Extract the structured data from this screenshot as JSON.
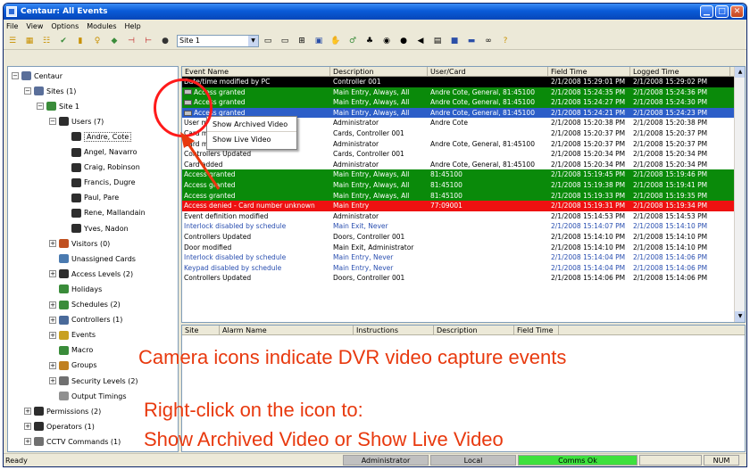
{
  "window": {
    "title": "Centaur: All Events"
  },
  "menu": [
    "File",
    "View",
    "Options",
    "Modules",
    "Help"
  ],
  "toolbar": {
    "site_value": "Site 1"
  },
  "tree": [
    {
      "label": "Centaur",
      "indent": 0,
      "pm": "−",
      "color": "#5a6f9a"
    },
    {
      "label": "Sites (1)",
      "indent": 1,
      "pm": "−",
      "color": "#5a6f9a"
    },
    {
      "label": "Site 1",
      "indent": 2,
      "pm": "−",
      "color": "#3a8c3a"
    },
    {
      "label": "Users (7)",
      "indent": 3,
      "pm": "−",
      "color": "#2d2d2d"
    },
    {
      "label": "Andre, Cote",
      "indent": 4,
      "pm": "",
      "color": "#2d2d2d",
      "sel": true
    },
    {
      "label": "Angel, Navarro",
      "indent": 4,
      "pm": "",
      "color": "#2d2d2d"
    },
    {
      "label": "Craig, Robinson",
      "indent": 4,
      "pm": "",
      "color": "#2d2d2d"
    },
    {
      "label": "Francis, Dugre",
      "indent": 4,
      "pm": "",
      "color": "#2d2d2d"
    },
    {
      "label": "Paul, Pare",
      "indent": 4,
      "pm": "",
      "color": "#2d2d2d"
    },
    {
      "label": "Rene, Mallandain",
      "indent": 4,
      "pm": "",
      "color": "#2d2d2d"
    },
    {
      "label": "Yves, Nadon",
      "indent": 4,
      "pm": "",
      "color": "#2d2d2d"
    },
    {
      "label": "Visitors (0)",
      "indent": 3,
      "pm": "+",
      "color": "#c05020"
    },
    {
      "label": "Unassigned Cards",
      "indent": 3,
      "pm": "",
      "color": "#4a7ab0"
    },
    {
      "label": "Access Levels (2)",
      "indent": 3,
      "pm": "+",
      "color": "#2d2d2d"
    },
    {
      "label": "Holidays",
      "indent": 3,
      "pm": "",
      "color": "#3a8c3a"
    },
    {
      "label": "Schedules (2)",
      "indent": 3,
      "pm": "+",
      "color": "#3a8c3a"
    },
    {
      "label": "Controllers (1)",
      "indent": 3,
      "pm": "+",
      "color": "#4a6a9a"
    },
    {
      "label": "Events",
      "indent": 3,
      "pm": "+",
      "color": "#c8a020"
    },
    {
      "label": "Macro",
      "indent": 3,
      "pm": "",
      "color": "#3a8c3a"
    },
    {
      "label": "Groups",
      "indent": 3,
      "pm": "+",
      "color": "#c08020"
    },
    {
      "label": "Security Levels (2)",
      "indent": 3,
      "pm": "+",
      "color": "#707070"
    },
    {
      "label": "Output Timings",
      "indent": 3,
      "pm": "",
      "color": "#909090"
    },
    {
      "label": "Permissions (2)",
      "indent": 1,
      "pm": "+",
      "color": "#2d2d2d"
    },
    {
      "label": "Operators (1)",
      "indent": 1,
      "pm": "+",
      "color": "#2d2d2d"
    },
    {
      "label": "CCTV Commands (1)",
      "indent": 1,
      "pm": "+",
      "color": "#707070"
    }
  ],
  "events": {
    "columns": [
      "Event Name",
      "Description",
      "User/Card",
      "Field Time",
      "Logged Time"
    ],
    "rows": [
      {
        "name": "Date/time modified by PC",
        "desc": "Controller 001",
        "user": "",
        "field": "2/1/2008 15:29:01 PM",
        "logged": "2/1/2008 15:29:02 PM",
        "bg": "#000000",
        "fg": "#ffffff"
      },
      {
        "name": "Access granted",
        "desc": "Main Entry, Always, All",
        "user": "Andre Cote, General, 81:45100",
        "field": "2/1/2008 15:24:35 PM",
        "logged": "2/1/2008 15:24:36 PM",
        "bg": "#0a8a0a",
        "fg": "#ffffff",
        "cam": true
      },
      {
        "name": "Access granted",
        "desc": "Main Entry, Always, All",
        "user": "Andre Cote, General, 81:45100",
        "field": "2/1/2008 15:24:27 PM",
        "logged": "2/1/2008 15:24:30 PM",
        "bg": "#0a8a0a",
        "fg": "#ffffff",
        "cam": true
      },
      {
        "name": "Access granted",
        "desc": "Main Entry, Always, All",
        "user": "Andre Cote, General, 81:45100",
        "field": "2/1/2008 15:24:21 PM",
        "logged": "2/1/2008 15:24:23 PM",
        "bg": "#2c5ec8",
        "fg": "#ffffff",
        "cam": true
      },
      {
        "name": "User modified",
        "desc": "Administrator",
        "user": "Andre Cote",
        "field": "2/1/2008 15:20:38 PM",
        "logged": "2/1/2008 15:20:38 PM",
        "bg": "#ffffff",
        "fg": "#000000"
      },
      {
        "name": "Card modified",
        "desc": "Cards, Controller 001",
        "user": "",
        "field": "2/1/2008 15:20:37 PM",
        "logged": "2/1/2008 15:20:37 PM",
        "bg": "#ffffff",
        "fg": "#000000"
      },
      {
        "name": "Card modified",
        "desc": "Administrator",
        "user": "Andre Cote, General, 81:45100",
        "field": "2/1/2008 15:20:37 PM",
        "logged": "2/1/2008 15:20:37 PM",
        "bg": "#ffffff",
        "fg": "#000000"
      },
      {
        "name": "Controllers Updated",
        "desc": "Cards, Controller 001",
        "user": "",
        "field": "2/1/2008 15:20:34 PM",
        "logged": "2/1/2008 15:20:34 PM",
        "bg": "#ffffff",
        "fg": "#000000"
      },
      {
        "name": "Card added",
        "desc": "Administrator",
        "user": "Andre Cote, General, 81:45100",
        "field": "2/1/2008 15:20:34 PM",
        "logged": "2/1/2008 15:20:34 PM",
        "bg": "#ffffff",
        "fg": "#000000"
      },
      {
        "name": "Access granted",
        "desc": "Main Entry, Always, All",
        "user": "81:45100",
        "field": "2/1/2008 15:19:45 PM",
        "logged": "2/1/2008 15:19:46 PM",
        "bg": "#0a8a0a",
        "fg": "#ffffff"
      },
      {
        "name": "Access granted",
        "desc": "Main Entry, Always, All",
        "user": "81:45100",
        "field": "2/1/2008 15:19:38 PM",
        "logged": "2/1/2008 15:19:41 PM",
        "bg": "#0a8a0a",
        "fg": "#ffffff"
      },
      {
        "name": "Access granted",
        "desc": "Main Entry, Always, All",
        "user": "81:45100",
        "field": "2/1/2008 15:19:33 PM",
        "logged": "2/1/2008 15:19:35 PM",
        "bg": "#0a8a0a",
        "fg": "#ffffff"
      },
      {
        "name": "Access denied - Card number unknown",
        "desc": "Main Entry",
        "user": "77:09001",
        "field": "2/1/2008 15:19:31 PM",
        "logged": "2/1/2008 15:19:34 PM",
        "bg": "#ee1111",
        "fg": "#ffffff"
      },
      {
        "name": "Event definition modified",
        "desc": "Administrator",
        "user": "",
        "field": "2/1/2008 15:14:53 PM",
        "logged": "2/1/2008 15:14:53 PM",
        "bg": "#ffffff",
        "fg": "#000000"
      },
      {
        "name": "Interlock disabled by schedule",
        "desc": "Main Exit, Never",
        "user": "",
        "field": "2/1/2008 15:14:07 PM",
        "logged": "2/1/2008 15:14:10 PM",
        "bg": "#ffffff",
        "fg": "#2a4fb0"
      },
      {
        "name": "Controllers Updated",
        "desc": "Doors, Controller 001",
        "user": "",
        "field": "2/1/2008 15:14:10 PM",
        "logged": "2/1/2008 15:14:10 PM",
        "bg": "#ffffff",
        "fg": "#000000"
      },
      {
        "name": "Door modified",
        "desc": "Main Exit, Administrator",
        "user": "",
        "field": "2/1/2008 15:14:10 PM",
        "logged": "2/1/2008 15:14:10 PM",
        "bg": "#ffffff",
        "fg": "#000000"
      },
      {
        "name": "Interlock disabled by schedule",
        "desc": "Main Entry, Never",
        "user": "",
        "field": "2/1/2008 15:14:04 PM",
        "logged": "2/1/2008 15:14:06 PM",
        "bg": "#ffffff",
        "fg": "#2a4fb0"
      },
      {
        "name": "Keypad disabled by schedule",
        "desc": "Main Entry, Never",
        "user": "",
        "field": "2/1/2008 15:14:04 PM",
        "logged": "2/1/2008 15:14:06 PM",
        "bg": "#ffffff",
        "fg": "#2a4fb0"
      },
      {
        "name": "Controllers Updated",
        "desc": "Doors, Controller 001",
        "user": "",
        "field": "2/1/2008 15:14:06 PM",
        "logged": "2/1/2008 15:14:06 PM",
        "bg": "#ffffff",
        "fg": "#000000"
      }
    ]
  },
  "context_menu": {
    "archived": "Show Archived Video",
    "live": "Show Live Video"
  },
  "alarms": {
    "columns": [
      "Site",
      "Alarm Name",
      "Instructions",
      "Description",
      "Field Time"
    ]
  },
  "annotations": {
    "line1": "Camera icons indicate DVR video capture events",
    "line2": "Right-click on the icon to:",
    "line3": "Show Archived Video or Show Live Video"
  },
  "status": {
    "ready": "Ready",
    "operator": "Administrator",
    "mode": "Local",
    "comms": "Comms Ok",
    "num": "NUM",
    "comms_color": "#3ee03e"
  }
}
